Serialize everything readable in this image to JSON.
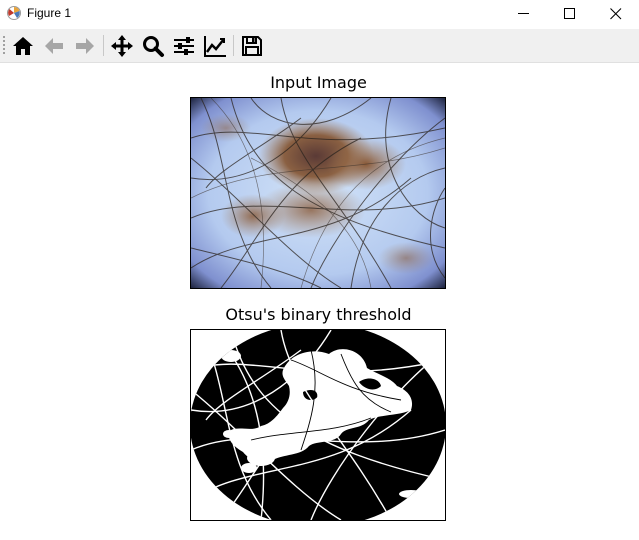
{
  "window": {
    "title": "Figure 1"
  },
  "toolbar": {
    "buttons": [
      "home-icon",
      "back-icon",
      "forward-icon",
      "pan-icon",
      "zoom-icon",
      "configure-subplots-icon",
      "edit-axis-icon",
      "save-icon"
    ]
  },
  "plots": [
    {
      "title": "Input Image"
    },
    {
      "title": "Otsu's binary threshold"
    }
  ]
}
